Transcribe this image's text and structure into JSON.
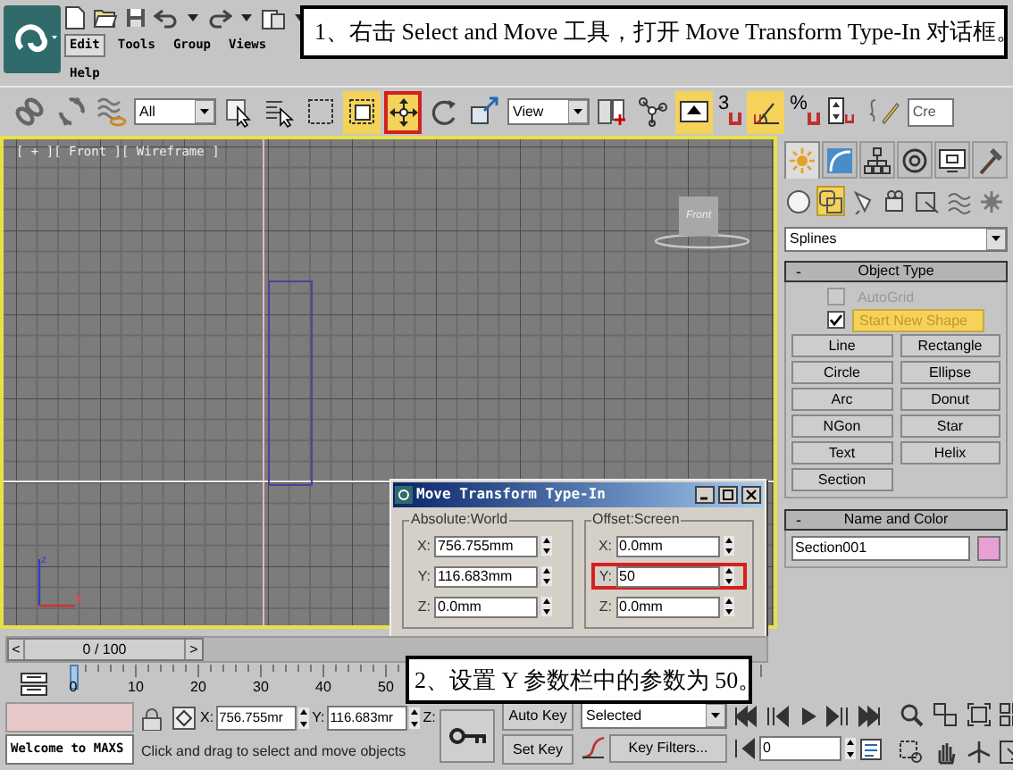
{
  "menu": [
    {
      "label": "Edit",
      "selected": true
    },
    {
      "label": "Tools",
      "selected": false
    },
    {
      "label": "Group",
      "selected": false
    },
    {
      "label": "Views",
      "selected": false
    },
    {
      "label": "Help",
      "selected": false
    }
  ],
  "toolbar": [
    {
      "kind": "tool",
      "on": false,
      "highlighted": false
    },
    {
      "kind": "tool",
      "on": false,
      "highlighted": false
    },
    {
      "kind": "tool",
      "on": false,
      "highlighted": false
    },
    {
      "kind": "dropdown",
      "value": "All"
    },
    {
      "kind": "tool",
      "on": false,
      "highlighted": false
    },
    {
      "kind": "tool",
      "on": false,
      "highlighted": false
    },
    {
      "kind": "tool",
      "on": false,
      "highlighted": false
    },
    {
      "kind": "tool",
      "on": true,
      "highlighted": false
    },
    {
      "kind": "tool",
      "on": true,
      "highlighted": true
    },
    {
      "kind": "tool",
      "on": false,
      "highlighted": false
    },
    {
      "kind": "tool",
      "on": false,
      "highlighted": false
    },
    {
      "kind": "dropdown",
      "value": "View"
    },
    {
      "kind": "tool",
      "on": false,
      "highlighted": false
    },
    {
      "kind": "tool",
      "on": false,
      "highlighted": false
    },
    {
      "kind": "tool",
      "on": true,
      "highlighted": false
    },
    {
      "kind": "snap",
      "label": "3",
      "on": false
    },
    {
      "kind": "tool",
      "on": true,
      "highlighted": false
    },
    {
      "kind": "snap",
      "label": "%",
      "on": false
    },
    {
      "kind": "tool",
      "on": false,
      "highlighted": false
    },
    {
      "kind": "tool",
      "on": false,
      "highlighted": false
    },
    {
      "kind": "field",
      "value": "Cre"
    }
  ],
  "viewport": {
    "label": "[ + ][ Front ][ Wireframe ]",
    "viewcube_label": "Front",
    "axis_labels": [
      "z",
      "x"
    ]
  },
  "dialog": {
    "title": "Move Transform Type-In",
    "groups": [
      {
        "title": "Absolute:World",
        "fields": [
          {
            "label": "X:",
            "value": "756.755mm",
            "highlighted": false
          },
          {
            "label": "Y:",
            "value": "116.683mm",
            "highlighted": false
          },
          {
            "label": "Z:",
            "value": "0.0mm",
            "highlighted": false
          }
        ]
      },
      {
        "title": "Offset:Screen",
        "fields": [
          {
            "label": "X:",
            "value": "0.0mm",
            "highlighted": false
          },
          {
            "label": "Y:",
            "value": "50",
            "highlighted": true
          },
          {
            "label": "Z:",
            "value": "0.0mm",
            "highlighted": false
          }
        ]
      }
    ]
  },
  "command_panel": {
    "tabs": [
      {
        "selected": true
      },
      {
        "selected": false
      },
      {
        "selected": false
      },
      {
        "selected": false
      },
      {
        "selected": false
      },
      {
        "selected": false
      }
    ],
    "categories": [
      {
        "selected": false
      },
      {
        "selected": true
      },
      {
        "selected": false
      },
      {
        "selected": false
      },
      {
        "selected": false
      },
      {
        "selected": false
      },
      {
        "selected": false
      }
    ],
    "type": "Splines",
    "object_type": {
      "collapse": "-",
      "title": "Object Type",
      "options": [
        {
          "label": "AutoGrid",
          "checked": false,
          "disabled": true
        },
        {
          "label": "Start New Shape",
          "checked": true,
          "disabled": false
        }
      ],
      "buttons": [
        "Line",
        "Rectangle",
        "Circle",
        "Ellipse",
        "Arc",
        "Donut",
        "NGon",
        "Star",
        "Text",
        "Helix",
        "Section"
      ]
    },
    "name_and_color": {
      "collapse": "-",
      "title": "Name and Color",
      "name": "Section001",
      "color": "#e8a0d4"
    }
  },
  "time_slider": {
    "prev": "<",
    "label": "0 / 100",
    "next": ">",
    "level": 0
  },
  "ruler_labels": [
    "0",
    "10",
    "20",
    "30",
    "40",
    "50"
  ],
  "status_bar": {
    "listener": "Welcome to MAXS",
    "coords": [
      {
        "label": "X:",
        "value": "756.755mr"
      },
      {
        "label": "Y:",
        "value": "116.683mr"
      },
      {
        "label": "Z:"
      }
    ],
    "prompt": "Click and drag to select and move objects",
    "auto_key": "Auto Key",
    "set_key": "Set Key",
    "key_set": "Selected",
    "key_filters": "Key Filters...",
    "frame": "0"
  },
  "callouts": [
    "1、右击 Select and Move 工具，打开 Move Transform Type-In 对话框。",
    "2、设置 Y 参数栏中的参数为 50。"
  ]
}
